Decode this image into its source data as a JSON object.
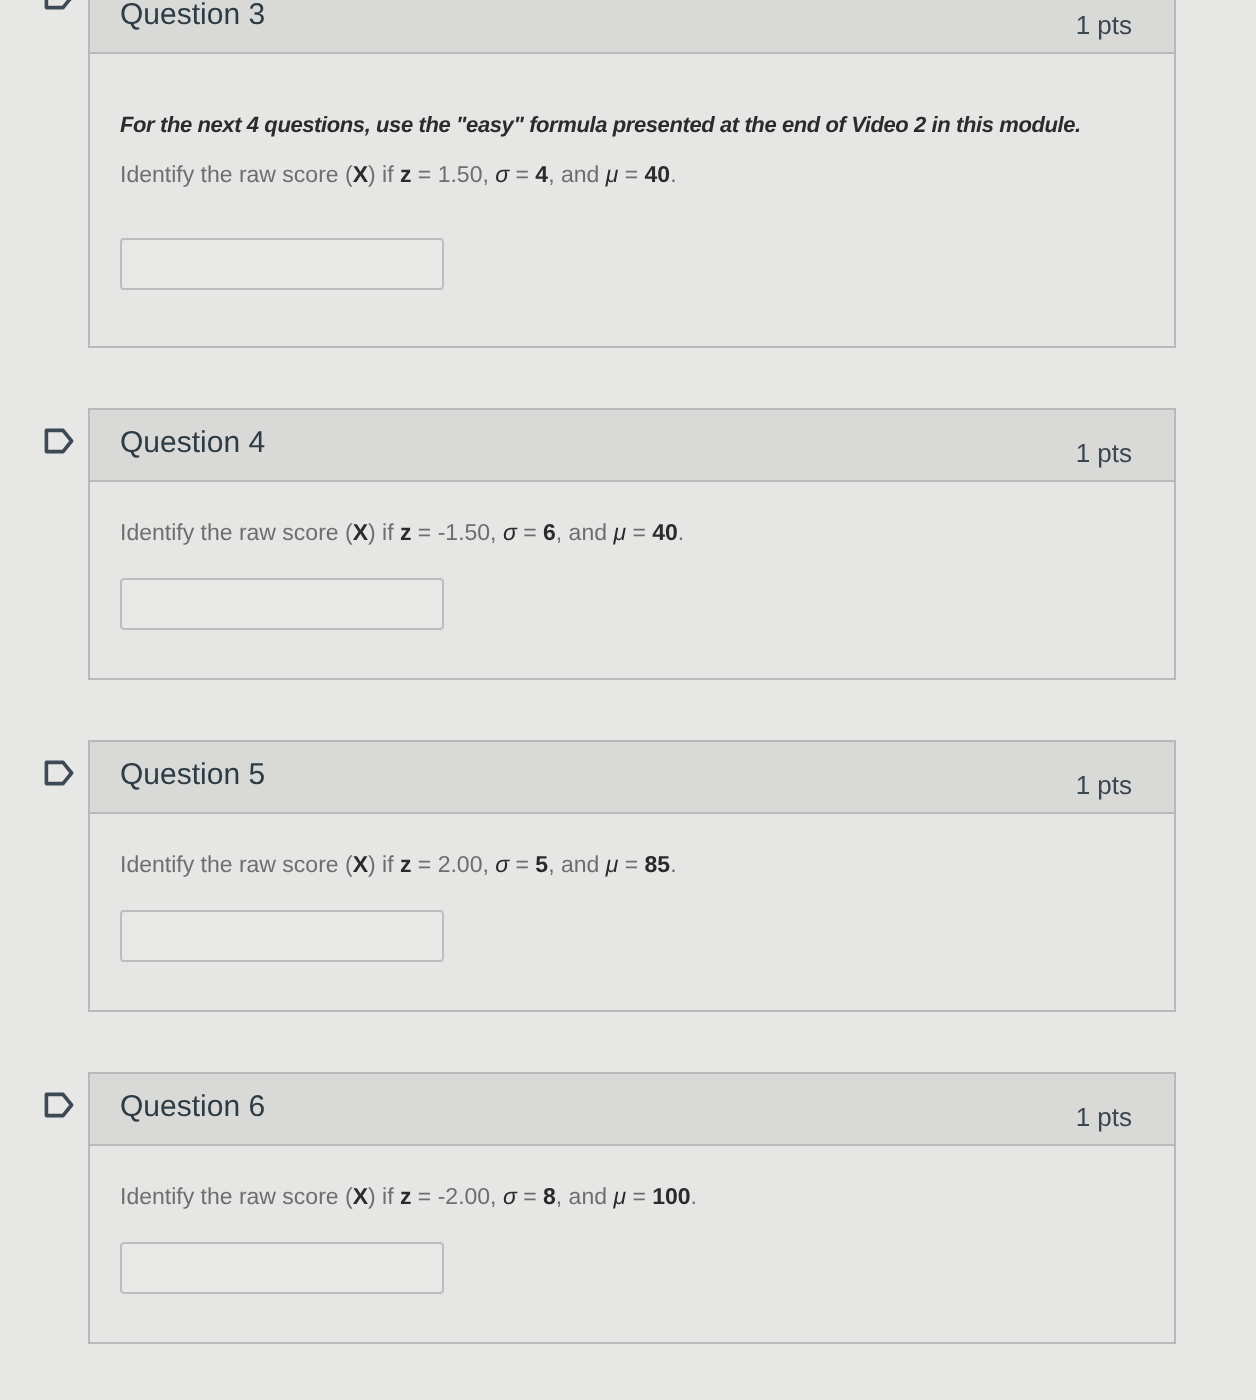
{
  "questions": [
    {
      "title": "Question 3",
      "points": "1 pts",
      "flagged": false,
      "instructions": "For the next 4 questions, use the \"easy\" formula presented at the end of Video 2 in this module.",
      "prompt": "Identify the raw score (**X**) if **z** = 1.50, *σ* = **4**, and *μ* = **40**."
    },
    {
      "title": "Question 4",
      "points": "1 pts",
      "flagged": false,
      "prompt": "Identify the raw score (**X**) if **z** = -1.50, *σ* = **6**, and *μ* = **40**."
    },
    {
      "title": "Question 5",
      "points": "1 pts",
      "flagged": false,
      "prompt": "Identify the raw score (**X**) if **z** = 2.00, *σ* = **5**, and *μ* = **85**."
    },
    {
      "title": "Question 6",
      "points": "1 pts",
      "flagged": false,
      "prompt": "Identify the raw score (**X**) if **z** = -2.00, *σ* = **8**, and *μ* = **100**."
    }
  ]
}
